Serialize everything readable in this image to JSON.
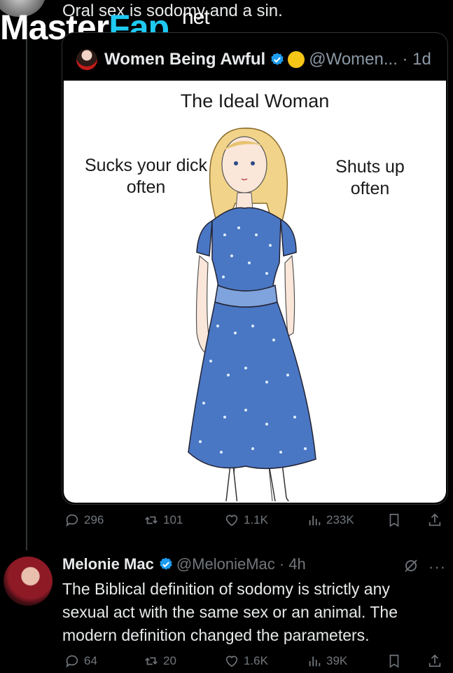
{
  "watermark": {
    "master": "Master",
    "fap": "Fap",
    "net": "net"
  },
  "parent_post": {
    "text": "Oral sex is sodomy and a sin."
  },
  "quote": {
    "author_name": "Women Being Awful",
    "handle_time": "@Women... · 1d",
    "meme": {
      "title": "The Ideal Woman",
      "left_caption": "Sucks your dick often",
      "right_caption": "Shuts up often"
    }
  },
  "post_actions": {
    "replies": "296",
    "reposts": "101",
    "likes": "1.1K",
    "views": "233K"
  },
  "reply": {
    "author_name": "Melonie Mac",
    "handle_time": "@MelonieMac · 4h",
    "more": "···",
    "text": "The Biblical definition of sodomy is strictly any sexual act with the same sex or an animal. The modern definition changed the parameters.",
    "actions": {
      "replies": "64",
      "reposts": "20",
      "likes": "1.6K",
      "views": "39K"
    }
  },
  "colors": {
    "background": "#000000",
    "muted": "#71767b",
    "verified": "#1d9bf0",
    "watermark_accent": "#1ec9f2"
  }
}
